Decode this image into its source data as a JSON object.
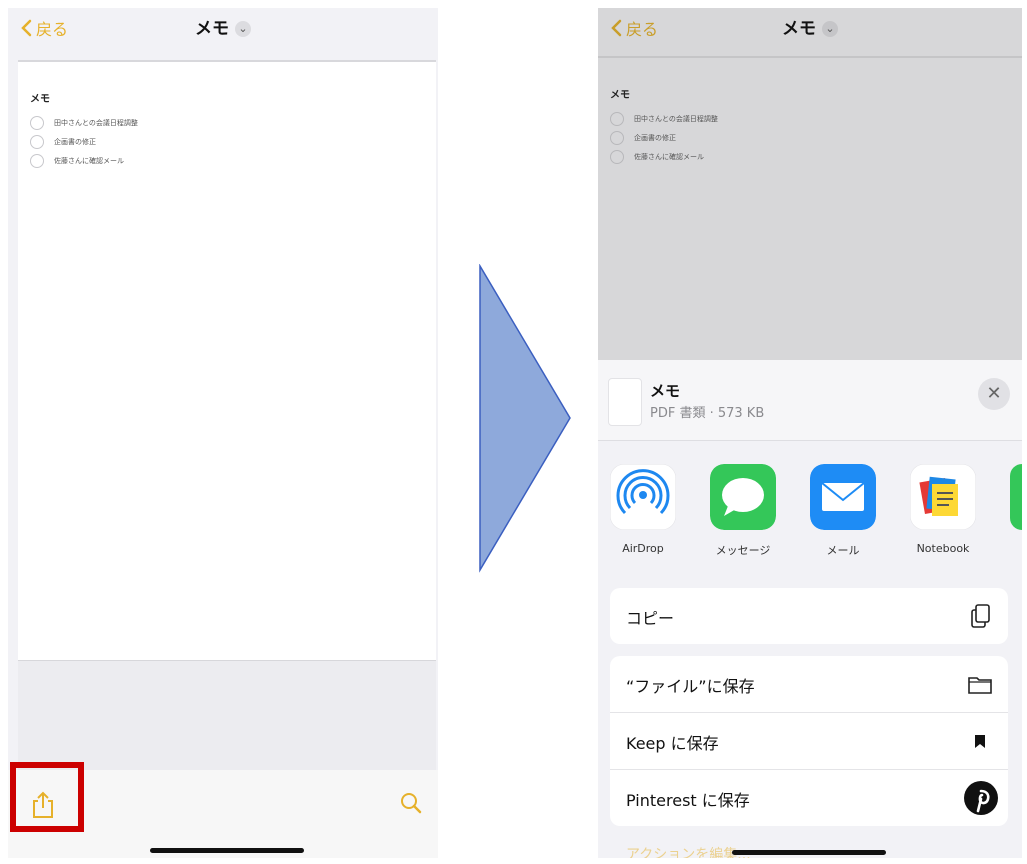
{
  "left": {
    "nav": {
      "back_label": "戻る",
      "title": "メモ"
    },
    "note": {
      "heading": "メモ",
      "items": [
        "田中さんとの会議日程調整",
        "企画書の修正",
        "佐藤さんに確認メール"
      ]
    }
  },
  "right": {
    "nav": {
      "back_label": "戻る",
      "title": "メモ"
    },
    "note": {
      "heading": "メモ",
      "items": [
        "田中さんとの会議日程調整",
        "企画書の修正",
        "佐藤さんに確認メール"
      ]
    },
    "share": {
      "file_name": "メモ",
      "file_meta": "PDF 書類 · 573 KB",
      "apps": [
        {
          "label": "AirDrop",
          "icon": "airdrop-icon"
        },
        {
          "label": "メッセージ",
          "icon": "messages-icon"
        },
        {
          "label": "メール",
          "icon": "mail-icon"
        },
        {
          "label": "Notebook",
          "icon": "notebook-icon"
        }
      ],
      "copy_label": "コピー",
      "actions": [
        {
          "label": "“ファイル”に保存",
          "icon": "folder-icon"
        },
        {
          "label": "Keep に保存",
          "icon": "bookmark-icon"
        },
        {
          "label": "Pinterest に保存",
          "icon": "pinterest-icon"
        }
      ],
      "edit_actions_label": "アクションを編集..."
    }
  },
  "colors": {
    "accent": "#e6b12b",
    "highlight": "#cc0000",
    "arrow": "#8ea9db"
  }
}
